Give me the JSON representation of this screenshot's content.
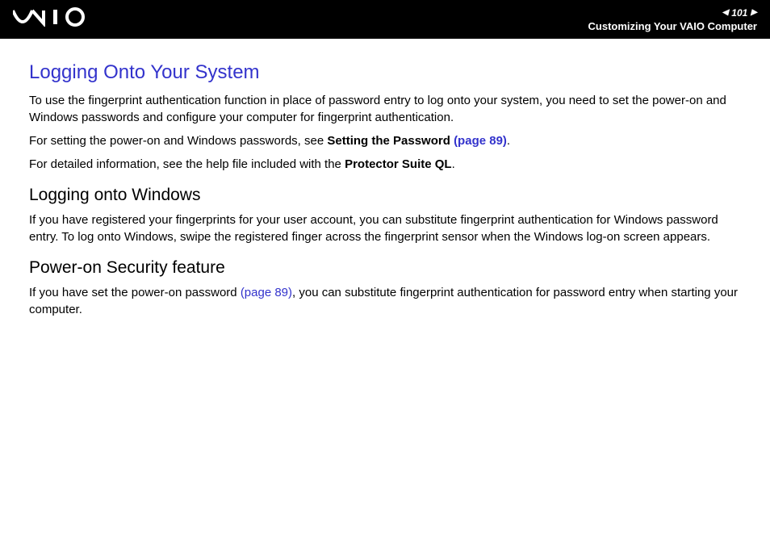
{
  "header": {
    "logo": "VAIO",
    "page_number": "101",
    "subtitle": "Customizing Your VAIO Computer"
  },
  "content": {
    "main_heading": "Logging Onto Your System",
    "para1": "To use the fingerprint authentication function in place of password entry to log onto your system, you need to set the power-on and Windows passwords and configure your computer for fingerprint authentication.",
    "para2_pre": "For setting the power-on and Windows passwords, see ",
    "para2_bold": "Setting the Password ",
    "para2_link": "(page 89)",
    "para2_post": ".",
    "para3_pre": "For detailed information, see the help file included with the ",
    "para3_bold": "Protector Suite QL",
    "para3_post": ".",
    "sub1_heading": "Logging onto Windows",
    "sub1_para": "If you have registered your fingerprints for your user account, you can substitute fingerprint authentication for Windows password entry. To log onto Windows, swipe the registered finger across the fingerprint sensor when the Windows log-on screen appears.",
    "sub2_heading": "Power-on Security feature",
    "sub2_para_pre": "If you have set the power-on password ",
    "sub2_para_link": "(page 89)",
    "sub2_para_post": ", you can substitute fingerprint authentication for password entry when starting your computer."
  }
}
